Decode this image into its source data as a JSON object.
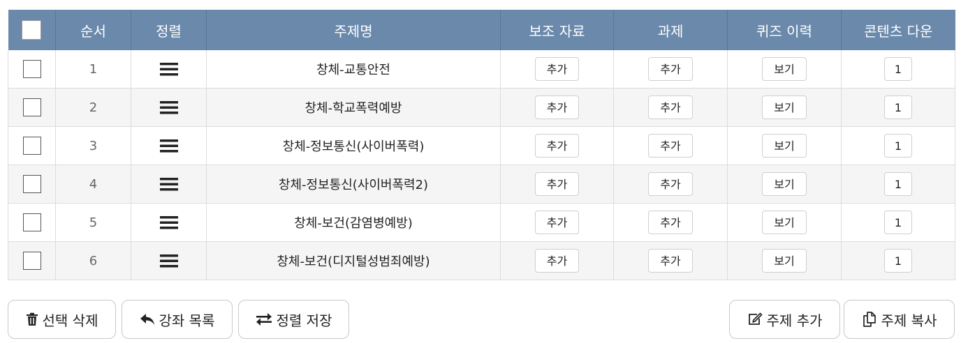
{
  "table": {
    "headers": {
      "order": "순서",
      "sort": "정렬",
      "topic": "주제명",
      "material": "보조 자료",
      "assignment": "과제",
      "quiz": "퀴즈 이력",
      "download": "콘텐츠 다운"
    },
    "rows": [
      {
        "num": "1",
        "title": "창체-교통안전",
        "material": "추가",
        "assignment": "추가",
        "quiz": "보기",
        "download": "1"
      },
      {
        "num": "2",
        "title": "창체-학교폭력예방",
        "material": "추가",
        "assignment": "추가",
        "quiz": "보기",
        "download": "1"
      },
      {
        "num": "3",
        "title": "창체-정보통신(사이버폭력)",
        "material": "추가",
        "assignment": "추가",
        "quiz": "보기",
        "download": "1"
      },
      {
        "num": "4",
        "title": "창체-정보통신(사이버폭력2)",
        "material": "추가",
        "assignment": "추가",
        "quiz": "보기",
        "download": "1"
      },
      {
        "num": "5",
        "title": "창체-보건(감염병예방)",
        "material": "추가",
        "assignment": "추가",
        "quiz": "보기",
        "download": "1"
      },
      {
        "num": "6",
        "title": "창체-보건(디지털성범죄예방)",
        "material": "추가",
        "assignment": "추가",
        "quiz": "보기",
        "download": "1"
      }
    ]
  },
  "actions": {
    "delete_selected": "선택 삭제",
    "course_list": "강좌 목록",
    "save_sort": "정렬 저장",
    "add_topic": "주제 추가",
    "copy_topic": "주제 복사"
  },
  "icons": {
    "delete": "trash-icon",
    "back": "reply-arrow-icon",
    "sort": "exchange-arrows-icon",
    "add": "edit-icon",
    "copy": "copy-icon",
    "drag": "drag-handle-icon"
  },
  "colors": {
    "header_bg": "#6a89ab",
    "header_text": "#ffffff",
    "stripe": "#f5f5f5"
  }
}
